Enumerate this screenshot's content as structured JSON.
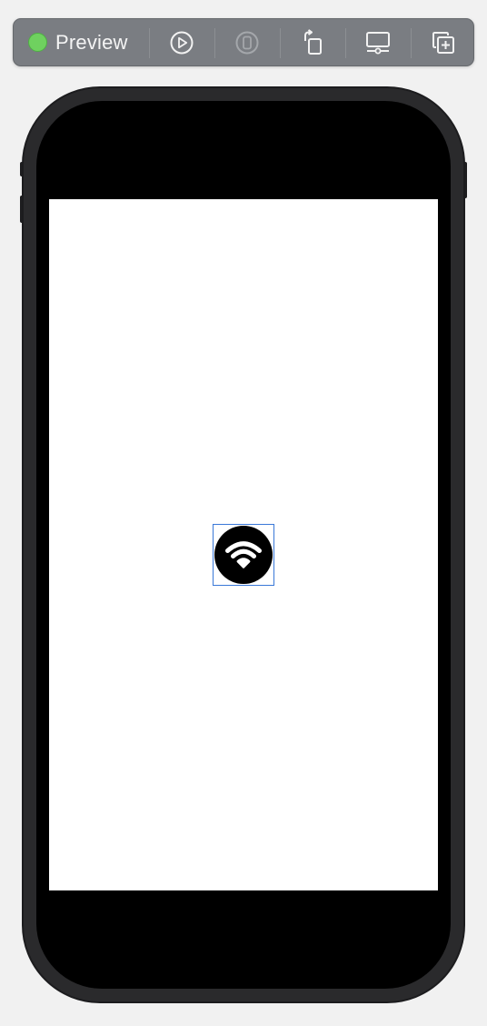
{
  "toolbar": {
    "title": "Preview",
    "status_color": "#6fd15f",
    "buttons": [
      {
        "name": "live-preview",
        "icon": "play-circle-icon"
      },
      {
        "name": "device-inspect",
        "icon": "device-icon",
        "disabled": true
      },
      {
        "name": "rotate",
        "icon": "rotate-device-icon"
      },
      {
        "name": "device-settings",
        "icon": "display-settings-icon"
      },
      {
        "name": "duplicate-preview",
        "icon": "duplicate-plus-icon"
      }
    ]
  },
  "canvas": {
    "selected_element": "wifi-badge",
    "selection_color": "#3a78d8",
    "icon": "wifi-icon"
  }
}
